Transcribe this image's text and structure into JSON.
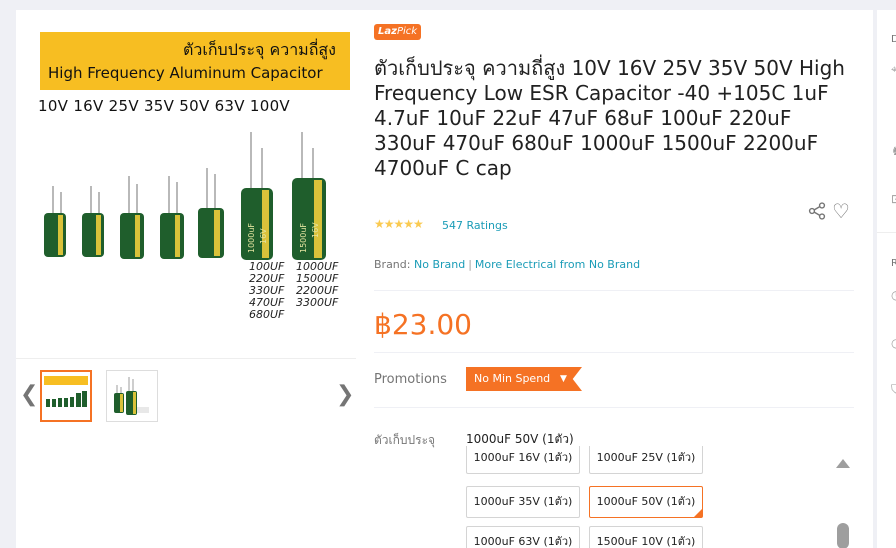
{
  "gallery": {
    "banner_thai": "ตัวเก็บประจุ ความถี่สูง",
    "banner_english": "High Frequency Aluminum Capacitor",
    "voltages": "10V 16V 25V 35V 50V 63V 100V",
    "values_col1": "100UF\n220UF\n330UF\n470UF\n680UF",
    "values_col2": "1000UF\n1500UF\n2200UF\n3300UF",
    "cap_labels": [
      "1000uF",
      "1500uF"
    ],
    "cap_voltages": [
      "16V",
      "16V"
    ],
    "prev_arrow": "❮",
    "next_arrow": "❯",
    "thumbnail_count": 2
  },
  "badge": {
    "prefix": "Laz",
    "suffix": "Pick"
  },
  "product": {
    "title": "ตัวเก็บประจุ ความถี่สูง 10V 16V 25V 35V 50V High Frequency Low ESR Capacitor -40 +105C 1uF 4.7uF 10uF 22uF 47uF 68uF 100uF 220uF 330uF 470uF 680uF 1000uF 1500uF 2200uF 4700uF C cap",
    "rating_stars": 4.5,
    "stars_glyph": "★★★★★",
    "ratings_text": "547 Ratings",
    "brand_label": "Brand:",
    "brand_value": "No Brand",
    "brand_more": "More Electrical from No Brand",
    "price": "฿23.00"
  },
  "icons": {
    "share": "share-icon",
    "heart": "heart-icon"
  },
  "promotions": {
    "label": "Promotions",
    "tag": "No Min Spend"
  },
  "variation": {
    "label": "ตัวเก็บประจุ",
    "selected": "1000uF 50V (1ตัว)",
    "options": [
      "1000uF 16V (1ตัว)",
      "1000uF 25V (1ตัว)",
      "1000uF 35V (1ตัว)",
      "1000uF 50V (1ตัว)",
      "1000uF 63V (1ตัว)",
      "1500uF 10V (1ตัว)"
    ]
  },
  "colors": {
    "accent": "#f57224",
    "link": "#1a9cb7",
    "banner": "#f7be22",
    "capacitor": "#1f5e2c"
  }
}
